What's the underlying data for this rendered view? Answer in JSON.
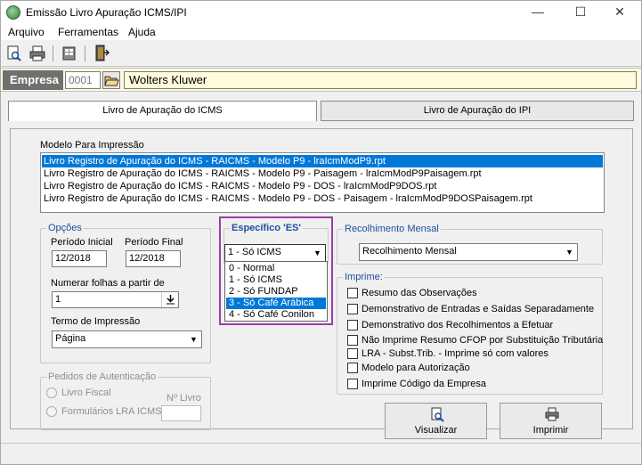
{
  "window": {
    "title": "Emissão Livro Apuração ICMS/IPI",
    "controls": {
      "minimize": "—",
      "maximize": "☐",
      "close": "✕"
    }
  },
  "menu": {
    "arquivo": "Arquivo",
    "ferramentas": "Ferramentas",
    "ajuda": "Ajuda"
  },
  "toolbar": {
    "icons": [
      "preview-icon",
      "print-icon",
      "tools-icon",
      "exit-icon"
    ]
  },
  "empresa": {
    "label": "Empresa",
    "code": "0001",
    "name": "Wolters Kluwer"
  },
  "tabs": [
    {
      "label": "Livro de Apuração do ICMS",
      "active": true
    },
    {
      "label": "Livro de Apuração do IPI",
      "active": false
    }
  ],
  "modelo": {
    "label": "Modelo Para Impressão",
    "items": [
      "Livro Registro de Apuração do ICMS - RAICMS - Modelo P9 - lraIcmModP9.rpt",
      "Livro Registro de Apuração do ICMS - RAICMS - Modelo P9 - Paisagem - lraIcmModP9Paisagem.rpt",
      "Livro Registro de Apuração do ICMS - RAICMS - Modelo P9 - DOS - lraIcmModP9DOS.rpt",
      "Livro Registro de Apuração do ICMS - RAICMS - Modelo P9 - DOS - Paisagem - lraIcmModP9DOSPaisagem.rpt"
    ],
    "selected_index": 0
  },
  "opcoes": {
    "title": "Opções",
    "periodo_inicial_label": "Período Inicial",
    "periodo_inicial": "12/2018",
    "periodo_final_label": "Período Final",
    "periodo_final": "12/2018",
    "numerar_label": "Numerar folhas a partir de",
    "numerar_value": "1",
    "termo_label": "Termo de Impressão",
    "termo_value": "Página"
  },
  "especifico": {
    "title": "Específico 'ES'",
    "value": "1 - Só ICMS",
    "options": [
      "0 - Normal",
      "1 - Só ICMS",
      "2 - Só FUNDAP",
      "3 - Só Café Arábica",
      "4 - Só Café Conilon"
    ],
    "highlighted_index": 3
  },
  "recolhimento": {
    "title": "Recolhimento Mensal",
    "value": "Recolhimento Mensal"
  },
  "imprime": {
    "title": "Imprime:",
    "options": [
      {
        "label": "Resumo das Observações",
        "checked": false
      },
      {
        "label": "Demonstrativo de Entradas e Saídas Separadamente",
        "checked": false
      },
      {
        "label": "Demonstrativo dos Recolhimentos a Efetuar",
        "checked": false
      },
      {
        "label": "Não Imprime Resumo CFOP por Substituição Tributária",
        "checked": false
      },
      {
        "label": "LRA - Subst.Trib. - Imprime só com valores",
        "checked": false
      },
      {
        "label": "Modelo para Autorização",
        "checked": false
      },
      {
        "label": "Imprime Código da Empresa",
        "checked": false
      }
    ]
  },
  "pedidos": {
    "title": "Pedidos de Autenticação",
    "livro_fiscal": "Livro Fiscal",
    "formularios": "Formulários LRA ICMS",
    "nlivro_label": "Nº Livro",
    "nlivro_value": ""
  },
  "buttons": {
    "visualizar": "Visualizar",
    "imprimir": "Imprimir"
  }
}
